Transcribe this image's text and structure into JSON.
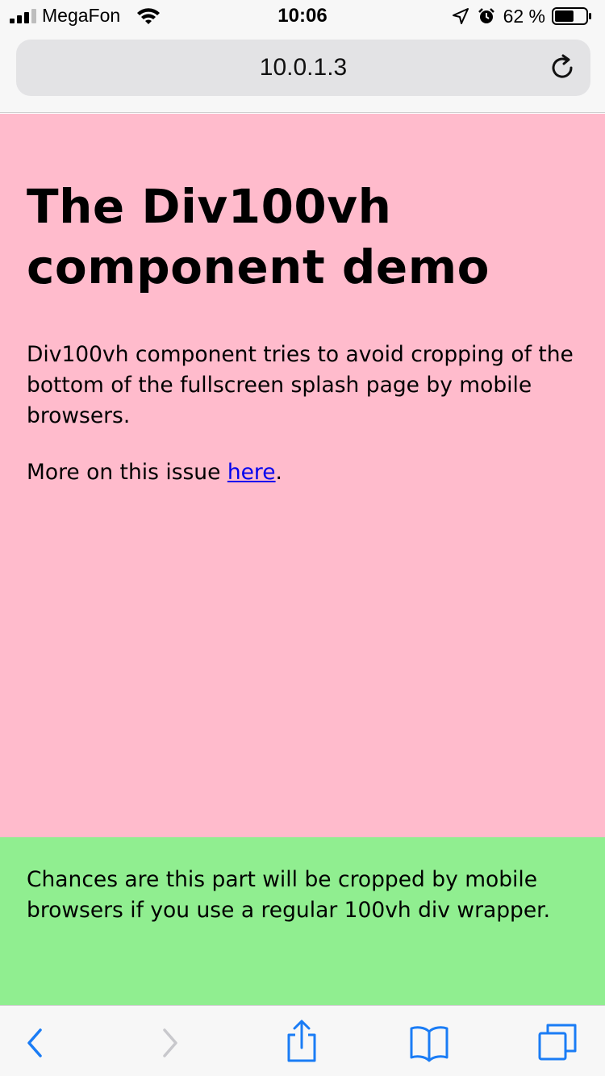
{
  "status_bar": {
    "carrier": "MegaFon",
    "time": "10:06",
    "battery_percent": "62 %",
    "battery_level": 0.62
  },
  "browser": {
    "url": "10.0.1.3",
    "back_enabled": true,
    "forward_enabled": false
  },
  "page": {
    "title": "The Div100vh component demo",
    "intro": "Div100vh component tries to avoid cropping of the bottom of the fullscreen splash page by mobile browsers.",
    "more_prefix": "More on this issue ",
    "more_link": "here",
    "more_suffix": ".",
    "bottom_text": "Chances are this part will be cropped by mobile browsers if you use a regular 100vh div wrapper."
  },
  "colors": {
    "pink_bg": "#ffbbcc",
    "green_bg": "#90ee90",
    "link": "#0000ee",
    "ios_blue": "#1a7cf5"
  },
  "toolbar": {
    "icons": [
      "back-icon",
      "forward-icon",
      "share-icon",
      "bookmarks-icon",
      "tabs-icon"
    ]
  }
}
